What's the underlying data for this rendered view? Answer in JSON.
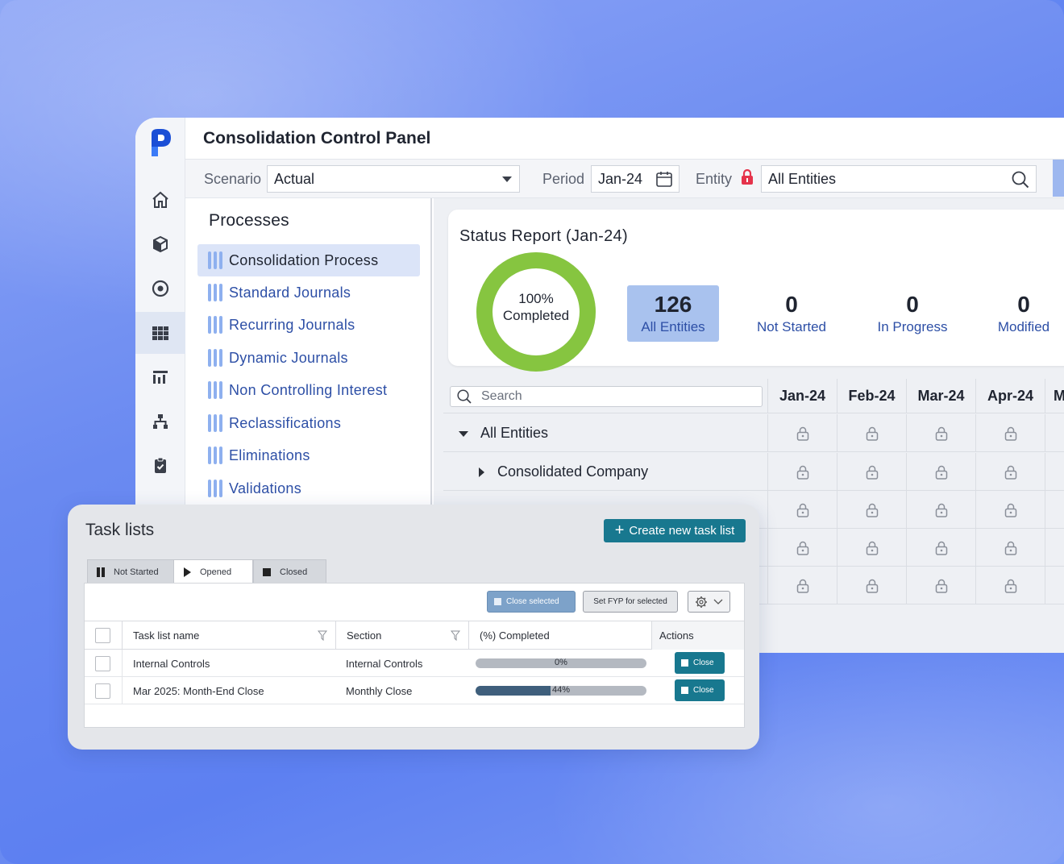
{
  "app": {
    "title": "Consolidation Control Panel",
    "nav_icons": [
      "home-icon",
      "cube-icon",
      "target-icon",
      "grid-icon",
      "report-icon",
      "hierarchy-icon",
      "clipboard-check-icon"
    ],
    "accent": "#2d4fa6"
  },
  "filters": {
    "scenario_label": "Scenario",
    "scenario_value": "Actual",
    "period_label": "Period",
    "period_value": "Jan-24",
    "entity_label": "Entity",
    "entity_value": "All Entities"
  },
  "processes": {
    "title": "Processes",
    "items": [
      {
        "label": "Consolidation Process"
      },
      {
        "label": "Standard Journals"
      },
      {
        "label": "Recurring Journals"
      },
      {
        "label": "Dynamic Journals"
      },
      {
        "label": "Non Controlling Interest"
      },
      {
        "label": "Reclassifications"
      },
      {
        "label": "Eliminations"
      },
      {
        "label": "Validations"
      }
    ]
  },
  "status": {
    "title": "Status Report (Jan-24)",
    "completed_pct": "100%",
    "completed_label": "Completed",
    "completed_fraction": 1.0,
    "donut_color": "#86c540",
    "stats": [
      {
        "num": "126",
        "label": "All Entities"
      },
      {
        "num": "0",
        "label": "Not Started"
      },
      {
        "num": "0",
        "label": "In Progress"
      },
      {
        "num": "0",
        "label": "Modified"
      }
    ]
  },
  "grid": {
    "search_placeholder": "Search",
    "columns": [
      "Jan-24",
      "Feb-24",
      "Mar-24",
      "Apr-24",
      "M"
    ],
    "rows": [
      {
        "label": "All Entities"
      },
      {
        "label": "Consolidated Company"
      }
    ]
  },
  "tasks": {
    "title": "Task lists",
    "create_label": "Create new task list",
    "tabs": [
      {
        "label": "Not Started"
      },
      {
        "label": "Opened"
      },
      {
        "label": "Closed"
      }
    ],
    "close_selected": "Close selected",
    "set_fyp": "Set FYP for selected",
    "headers": {
      "name": "Task list name",
      "section": "Section",
      "completed": "(%) Completed",
      "actions": "Actions"
    },
    "rows": [
      {
        "name": "Internal Controls",
        "section": "Internal Controls",
        "pct_text": "0%",
        "pct": 0,
        "action": "Close"
      },
      {
        "name": "Mar 2025: Month-End Close",
        "section": "Monthly Close",
        "pct_text": "44%",
        "pct": 44,
        "action": "Close"
      }
    ]
  }
}
